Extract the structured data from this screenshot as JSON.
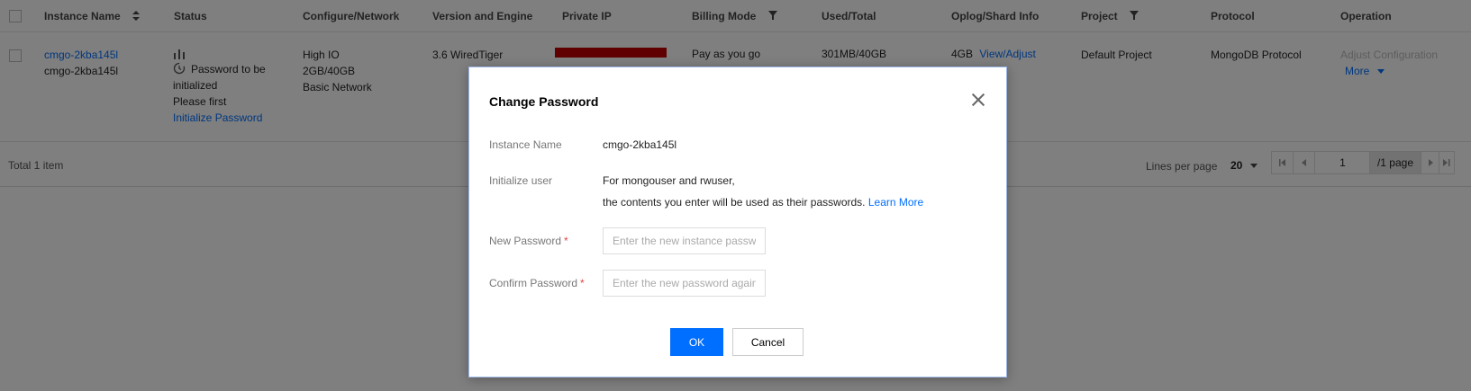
{
  "table": {
    "headers": {
      "instance_name": "Instance Name",
      "status": "Status",
      "configure": "Configure/Network",
      "version": "Version and Engine",
      "private_ip": "Private IP",
      "billing": "Billing Mode",
      "used_total": "Used/Total",
      "oplog": "Oplog/Shard Info",
      "project": "Project",
      "protocol": "Protocol",
      "operation": "Operation"
    },
    "row": {
      "instance_id": "cmgo-2kba145l",
      "instance_name": "cmgo-2kba145l",
      "status_line1": "Password to be",
      "status_line2": "initialized",
      "status_line3": "Please first",
      "status_link": "Initialize Password",
      "config_line1": "High IO",
      "config_line2": "2GB/40GB",
      "config_line3": "Basic Network",
      "version": "3.6 WiredTiger",
      "billing": "Pay as you go",
      "used_total": "301MB/40GB",
      "oplog": "4GB",
      "oplog_link": "View/Adjust",
      "project": "Default Project",
      "protocol": "MongoDB Protocol",
      "op_adjust": "Adjust Configuration",
      "op_more": "More"
    }
  },
  "footer": {
    "total": "Total 1 item",
    "lines_per_page_label": "Lines per page",
    "lines_per_page_value": "20",
    "page_input": "1",
    "page_total": "/1 page"
  },
  "modal": {
    "title": "Change Password",
    "instance_name_label": "Instance Name",
    "instance_name_value": "cmgo-2kba145l",
    "init_user_label": "Initialize user",
    "init_user_line1": "For mongouser and rwuser,",
    "init_user_line2": "the contents you enter will be used as their passwords.",
    "learn_more": "Learn More",
    "new_password_label": "New Password",
    "new_password_placeholder": "Enter the new instance password",
    "confirm_password_label": "Confirm Password",
    "confirm_password_placeholder": "Enter the new password again",
    "required_mark": "*",
    "ok": "OK",
    "cancel": "Cancel"
  },
  "colors": {
    "accent": "#006eff",
    "required": "#e54545",
    "masked_ip": "#c00000"
  }
}
